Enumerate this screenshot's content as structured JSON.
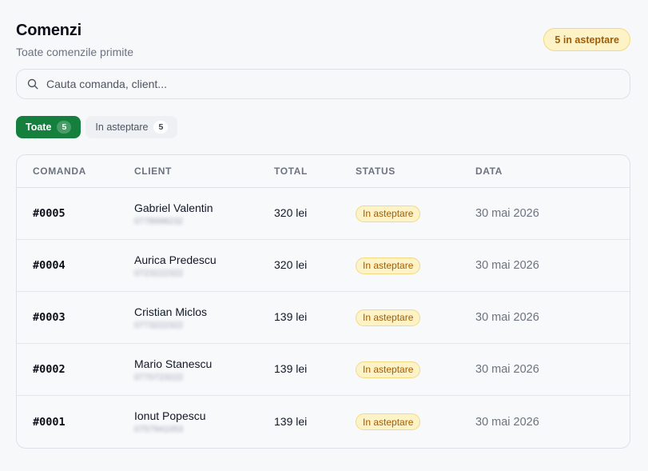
{
  "header": {
    "title": "Comenzi",
    "subtitle": "Toate comenzile primite",
    "pending_summary": "5 in asteptare"
  },
  "search": {
    "placeholder": "Cauta comanda, client...",
    "icon": "search-icon"
  },
  "tabs": [
    {
      "label": "Toate",
      "count": "5",
      "active": true
    },
    {
      "label": "In asteptare",
      "count": "5",
      "active": false
    }
  ],
  "table": {
    "columns": [
      "COMANDA",
      "CLIENT",
      "TOTAL",
      "STATUS",
      "DATA"
    ],
    "rows": [
      {
        "id": "#0005",
        "client": "Gabriel Valentin",
        "phone": "0778998232",
        "total": "320 lei",
        "status": "In asteptare",
        "date": "30 mai 2026"
      },
      {
        "id": "#0004",
        "client": "Aurica Predescu",
        "phone": "0723222322",
        "total": "320 lei",
        "status": "In asteptare",
        "date": "30 mai 2026"
      },
      {
        "id": "#0003",
        "client": "Cristian Miclos",
        "phone": "0773222322",
        "total": "139 lei",
        "status": "In asteptare",
        "date": "30 mai 2026"
      },
      {
        "id": "#0002",
        "client": "Mario Stanescu",
        "phone": "0770723222",
        "total": "139 lei",
        "status": "In asteptare",
        "date": "30 mai 2026"
      },
      {
        "id": "#0001",
        "client": "Ionut Popescu",
        "phone": "0757941053",
        "total": "139 lei",
        "status": "In asteptare",
        "date": "30 mai 2026"
      }
    ]
  },
  "colors": {
    "accent": "#15803d",
    "pending_bg": "#fdf3c7",
    "pending_border": "#f3d982",
    "pending_text": "#a15c07",
    "background": "#f7f8fa"
  }
}
